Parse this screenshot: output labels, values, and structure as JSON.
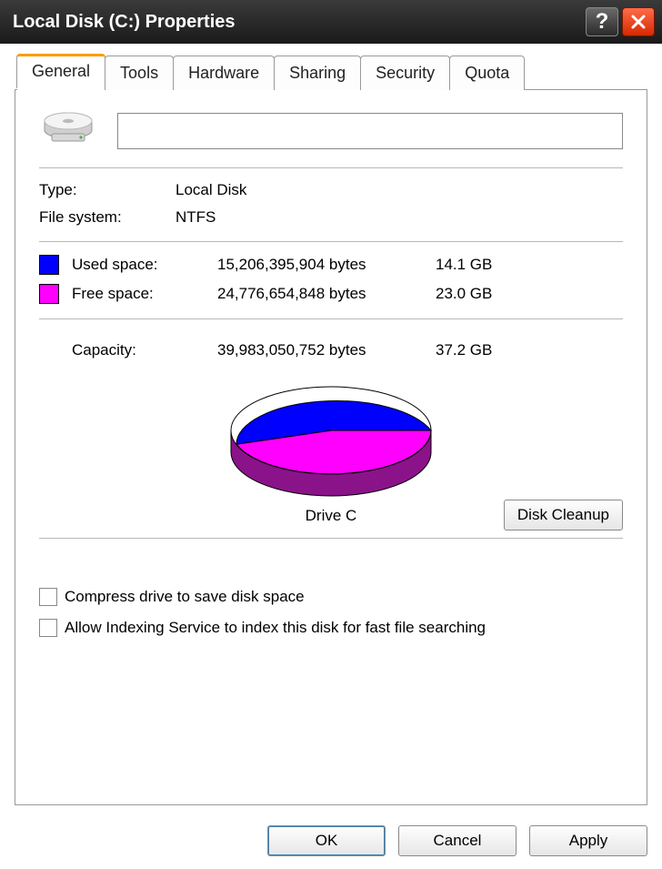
{
  "window": {
    "title": "Local Disk (C:) Properties"
  },
  "tabs": [
    "General",
    "Tools",
    "Hardware",
    "Sharing",
    "Security",
    "Quota"
  ],
  "active_tab": 0,
  "name_field": {
    "value": ""
  },
  "type": {
    "label": "Type:",
    "value": "Local Disk"
  },
  "filesystem": {
    "label": "File system:",
    "value": "NTFS"
  },
  "used": {
    "label": "Used space:",
    "bytes": "15,206,395,904 bytes",
    "human": "14.1 GB",
    "color": "#0000ff"
  },
  "free": {
    "label": "Free space:",
    "bytes": "24,776,654,848 bytes",
    "human": "23.0 GB",
    "color": "#ff00ff"
  },
  "capacity": {
    "label": "Capacity:",
    "bytes": "39,983,050,752 bytes",
    "human": "37.2 GB"
  },
  "drive_label": "Drive C",
  "disk_cleanup": "Disk Cleanup",
  "compress": {
    "label": "Compress drive to save disk space",
    "checked": false
  },
  "indexing": {
    "label": "Allow Indexing Service to index this disk for fast file searching",
    "checked": false
  },
  "buttons": {
    "ok": "OK",
    "cancel": "Cancel",
    "apply": "Apply"
  },
  "chart_data": {
    "type": "pie",
    "title": "Drive C",
    "series": [
      {
        "name": "Used space",
        "value": 15206395904,
        "color": "#0000ff"
      },
      {
        "name": "Free space",
        "value": 24776654848,
        "color": "#ff00ff"
      }
    ]
  }
}
